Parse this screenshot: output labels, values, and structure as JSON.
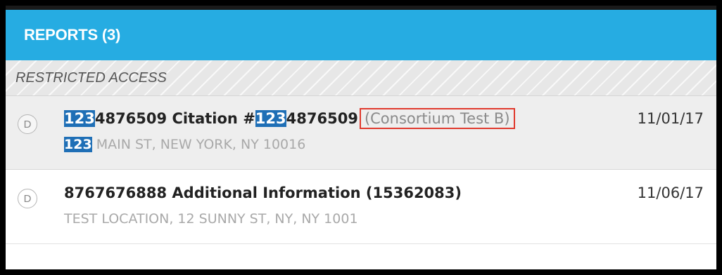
{
  "header": {
    "title": "REPORTS (3)"
  },
  "section": {
    "label": "RESTRICTED ACCESS"
  },
  "reports": [
    {
      "badge": "D",
      "highlight": "123",
      "id_rest": "4876509",
      "citation_prefix": " Citation #",
      "citation_rest": "4876509",
      "organization": "(Consortium Test B)",
      "address_rest": " MAIN ST, NEW YORK, NY 10016",
      "date": "11/01/17"
    },
    {
      "badge": "D",
      "title": "8767676888 Additional Information (15362083)",
      "address": "TEST LOCATION, 12 SUNNY ST, NY, NY 1001",
      "date": "11/06/17"
    }
  ],
  "colors": {
    "header_bg": "#26ace2",
    "highlight_bg": "#1f6fb6",
    "outline_red": "#e0392d"
  }
}
